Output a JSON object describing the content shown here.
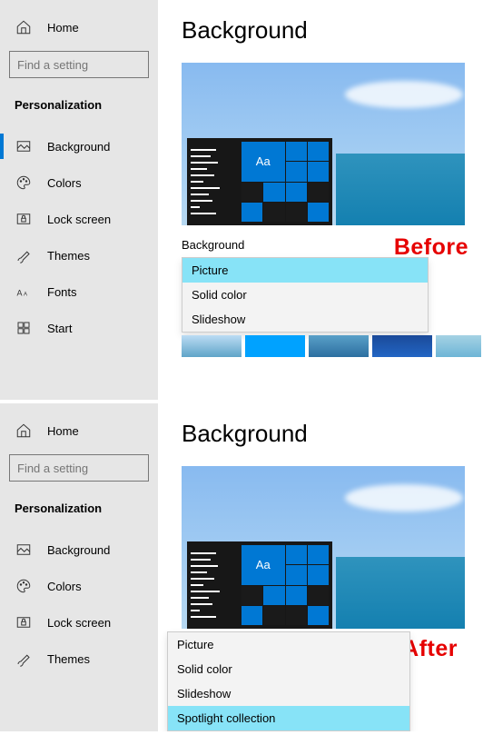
{
  "before": {
    "title": "Background",
    "callout": "Before",
    "sidebar": {
      "home": "Home",
      "search_placeholder": "Find a setting",
      "section": "Personalization",
      "items": [
        {
          "label": "Background",
          "selected": true
        },
        {
          "label": "Colors"
        },
        {
          "label": "Lock screen"
        },
        {
          "label": "Themes"
        },
        {
          "label": "Fonts"
        },
        {
          "label": "Start"
        }
      ]
    },
    "preview_tile_text": "Aa",
    "dropdown": {
      "label": "Background",
      "options": [
        "Picture",
        "Solid color",
        "Slideshow"
      ],
      "selected": "Picture"
    }
  },
  "after": {
    "title": "Background",
    "callout": "After",
    "sidebar": {
      "home": "Home",
      "search_placeholder": "Find a setting",
      "section": "Personalization",
      "items": [
        {
          "label": "Background"
        },
        {
          "label": "Colors"
        },
        {
          "label": "Lock screen"
        },
        {
          "label": "Themes"
        }
      ]
    },
    "preview_tile_text": "Aa",
    "dropdown": {
      "options": [
        "Picture",
        "Solid color",
        "Slideshow",
        "Spotlight collection"
      ],
      "selected": "Spotlight collection"
    }
  }
}
